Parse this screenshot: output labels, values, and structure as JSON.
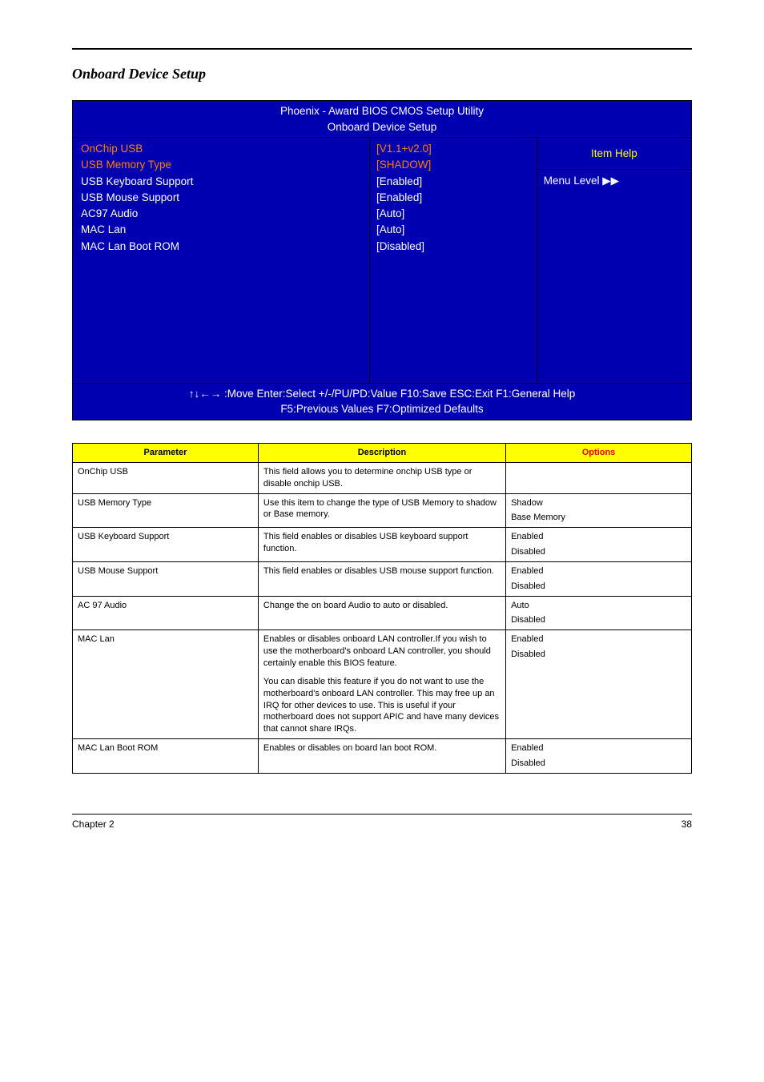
{
  "section_title": "Onboard Device Setup",
  "bios": {
    "header1": "Phoenix - Award BIOS CMOS Setup Utility",
    "header2": "Onboard Device Setup",
    "left_labels": {
      "onchip_usb": "OnChip USB",
      "usb_memory_type": "USB Memory Type",
      "usb_keyboard": "USB Keyboard Support",
      "usb_mouse": "USB Mouse Support",
      "ac97": "AC97 Audio",
      "mac_lan": "MAC Lan",
      "mac_lan_boot": "MAC Lan Boot ROM"
    },
    "mid_values": {
      "onchip_usb": "[V1.1+v2.0]",
      "usb_memory_type": "[SHADOW]",
      "usb_keyboard": "[Enabled]",
      "usb_mouse": "[Enabled]",
      "ac97": "[Auto]",
      "mac_lan": "[Auto]",
      "mac_lan_boot": "[Disabled]"
    },
    "right": {
      "item_help": "Item Help",
      "menu_level": "Menu Level ▶▶"
    },
    "footer1": "↑↓←→ :Move  Enter:Select   +/-/PU/PD:Value  F10:Save  ESC:Exit  F1:General Help",
    "footer2": "F5:Previous Values  F7:Optimized Defaults"
  },
  "table_headers": {
    "parameter": "Parameter",
    "description": "Description",
    "options": "Options"
  },
  "rows": [
    {
      "param": "OnChip USB",
      "desc": "This field allows you to determine onchip USB type or disable onchip USB.",
      "opt1": "",
      "opt2": ""
    },
    {
      "param": "USB Memory Type",
      "desc": "Use this item to change the type of USB Memory to shadow or Base memory.",
      "opt1": "Shadow",
      "opt2": "Base Memory"
    },
    {
      "param": "USB Keyboard Support",
      "desc": "This field enables or disables USB keyboard support function.",
      "opt1": "Enabled",
      "opt2": "Disabled"
    },
    {
      "param": "USB Mouse Support",
      "desc": "This field enables or disables USB mouse support function.",
      "opt1": "Enabled",
      "opt2": "Disabled"
    },
    {
      "param": "AC 97 Audio",
      "desc": "Change the on board Audio to auto or disabled.",
      "opt1": "Auto",
      "opt2": "Disabled"
    },
    {
      "param": "MAC Lan",
      "desc_p1": "Enables or disables onboard LAN controller.If you wish to use the motherboard's onboard LAN controller, you should certainly enable this BIOS feature.",
      "desc_p2": "You can disable this feature if you do not want to use the motherboard's onboard LAN controller. This may free up an IRQ for other devices to use. This is useful if your motherboard does not support APIC and have many devices that cannot share IRQs.",
      "opt1": "Enabled",
      "opt2": "Disabled"
    },
    {
      "param": "MAC Lan Boot ROM",
      "desc": "Enables or disables on board lan boot ROM.",
      "opt1": "Enabled",
      "opt2": "Disabled"
    }
  ],
  "footer": {
    "left": "Chapter 2",
    "right": "38"
  }
}
